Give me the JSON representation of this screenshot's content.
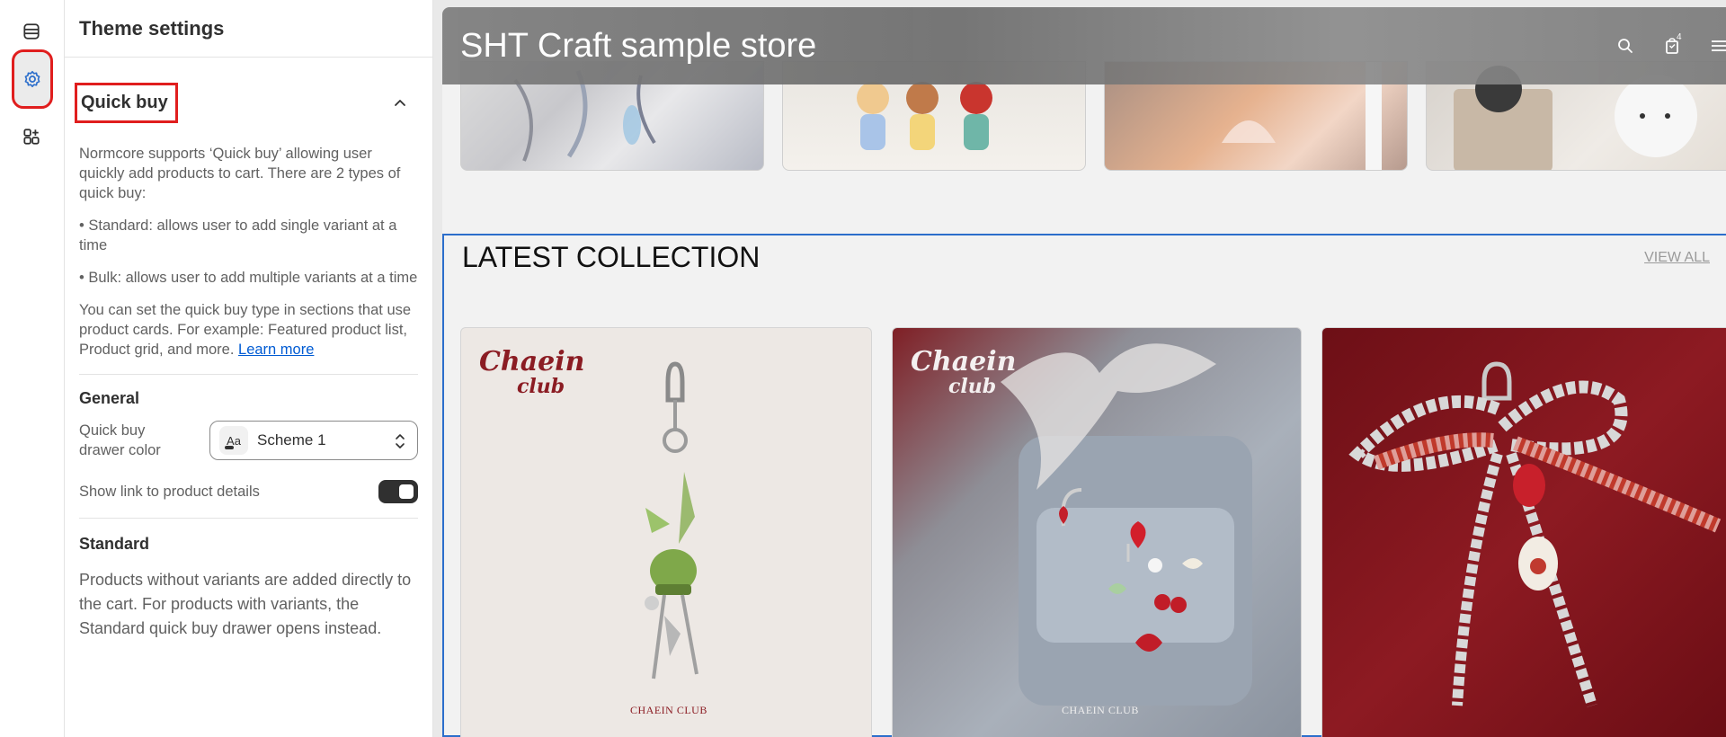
{
  "panel": {
    "title": "Theme settings",
    "section_title": "Quick buy",
    "intro": "Normcore supports ‘Quick buy’ allowing user quickly add products to cart. There are 2 types of quick buy:",
    "bullet_standard": "• Standard: allows user to add single variant at a time",
    "bullet_bulk": "• Bulk: allows user to add multiple variants at a time",
    "set_text": "You can set the quick buy type in sections that use product cards. For example: Featured product list, Product grid, and more.",
    "learn_more": "Learn more",
    "general_title": "General",
    "drawer_color_label": "Quick buy drawer color",
    "drawer_color_value": "Scheme 1",
    "swatch_text": "Aa",
    "show_link_label": "Show link to product details",
    "show_link_enabled": true,
    "standard_title": "Standard",
    "standard_text": "Products without variants are added directly to the cart. For products with variants, the Standard quick buy drawer opens instead."
  },
  "rail": {
    "items": [
      {
        "icon": "sections-icon",
        "active": false
      },
      {
        "icon": "gear-icon",
        "active": true
      },
      {
        "icon": "apps-add-icon",
        "active": false
      }
    ]
  },
  "store": {
    "name": "SHT Craft sample store",
    "cart_count": "4",
    "collection_title": "LATEST COLLECTION",
    "view_all": "VIEW ALL",
    "brand_script": "Chaein",
    "brand_script_sub": "club",
    "brand_caption": "CHAEIN CLUB"
  },
  "colors": {
    "accent": "#2c6ecb",
    "highlight": "#e01e1e",
    "link": "#005bd3",
    "brand": "#8b1c23"
  }
}
